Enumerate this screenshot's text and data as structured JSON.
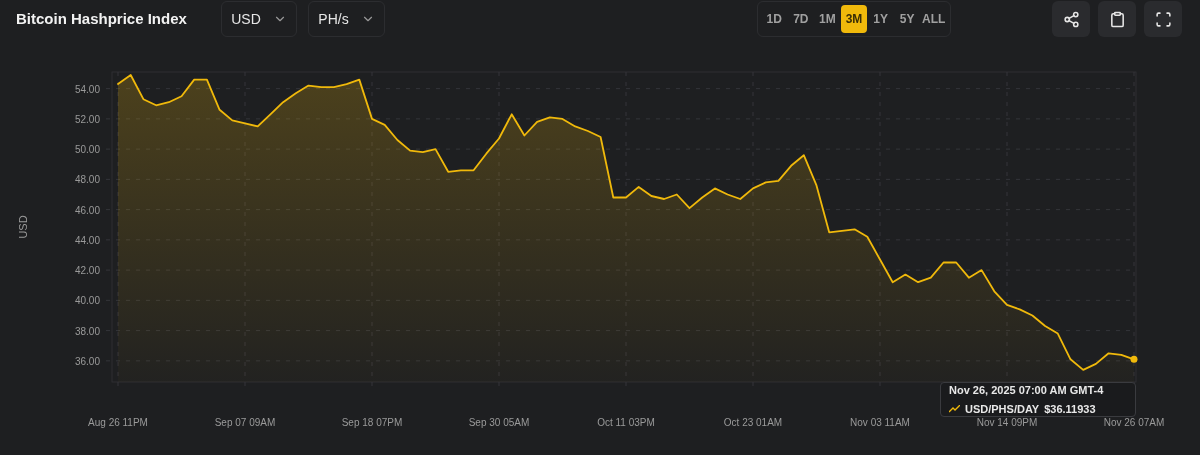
{
  "header": {
    "title": "Bitcoin Hashprice Index",
    "currency": {
      "value": "USD"
    },
    "unit": {
      "value": "PH/s"
    },
    "ranges": [
      {
        "label": "1D",
        "selected": false
      },
      {
        "label": "7D",
        "selected": false
      },
      {
        "label": "1M",
        "selected": false
      },
      {
        "label": "3M",
        "selected": true
      },
      {
        "label": "1Y",
        "selected": false
      },
      {
        "label": "5Y",
        "selected": false
      },
      {
        "label": "ALL",
        "selected": false
      }
    ],
    "actions": [
      {
        "kind": "share"
      },
      {
        "kind": "clipboard"
      },
      {
        "kind": "fullscreen"
      }
    ]
  },
  "chart": {
    "chart_data": {
      "type": "area",
      "grid": true,
      "ylabel": "USD",
      "categories": [
        "Aug 26 11PM",
        null,
        null,
        null,
        null,
        null,
        null,
        null,
        null,
        null,
        "Sep 07 09AM",
        null,
        null,
        null,
        null,
        null,
        null,
        null,
        null,
        null,
        "Sep 18 07PM",
        null,
        null,
        null,
        null,
        null,
        null,
        null,
        null,
        null,
        "Sep 30 05AM",
        null,
        null,
        null,
        null,
        null,
        null,
        null,
        null,
        null,
        "Oct 11 03PM",
        null,
        null,
        null,
        null,
        null,
        null,
        null,
        null,
        null,
        "Oct 23 01AM",
        null,
        null,
        null,
        null,
        null,
        null,
        null,
        null,
        null,
        "Nov 03 11AM",
        null,
        null,
        null,
        null,
        null,
        null,
        null,
        null,
        null,
        "Nov 14 09PM",
        null,
        null,
        null,
        null,
        null,
        null,
        null,
        null,
        null,
        "Nov 26 07AM"
      ],
      "series": [
        {
          "name": "USD/PHS/DAY",
          "color": "#f0b90b",
          "values": [
            54.3,
            54.9,
            53.3,
            52.9,
            53.1,
            53.5,
            54.6,
            54.6,
            52.6,
            51.9,
            51.7,
            51.5,
            52.3,
            53.1,
            53.7,
            54.2,
            54.1,
            54.1,
            54.3,
            54.6,
            52.0,
            51.6,
            50.6,
            49.9,
            49.8,
            50.0,
            48.5,
            48.6,
            48.6,
            49.7,
            50.7,
            52.3,
            50.9,
            51.8,
            52.1,
            52.0,
            51.5,
            51.2,
            50.8,
            46.8,
            46.8,
            47.5,
            46.9,
            46.7,
            47.0,
            46.1,
            46.8,
            47.4,
            47.0,
            46.7,
            47.4,
            47.8,
            47.9,
            48.9,
            49.6,
            47.6,
            44.5,
            44.6,
            44.7,
            44.2,
            42.7,
            41.2,
            41.7,
            41.2,
            41.5,
            42.5,
            42.5,
            41.5,
            42.0,
            40.6,
            39.7,
            39.4,
            39.0,
            38.3,
            37.8,
            36.1,
            35.4,
            35.8,
            36.5,
            36.4,
            36.1
          ]
        }
      ],
      "ylim": [
        34.6,
        55.1
      ],
      "yticks": [
        {
          "value": 36,
          "label": "36.00"
        },
        {
          "value": 38,
          "label": "38.00"
        },
        {
          "value": 40,
          "label": "40.00"
        },
        {
          "value": 42,
          "label": "42.00"
        },
        {
          "value": 44,
          "label": "44.00"
        },
        {
          "value": 46,
          "label": "46.00"
        },
        {
          "value": 48,
          "label": "48.00"
        },
        {
          "value": 50,
          "label": "50.00"
        },
        {
          "value": 52,
          "label": "52.00"
        },
        {
          "value": 54,
          "label": "54.00"
        }
      ]
    },
    "tooltip": {
      "time": "Nov 26, 2025 07:00 AM GMT-4",
      "value": "$36.11933"
    }
  }
}
